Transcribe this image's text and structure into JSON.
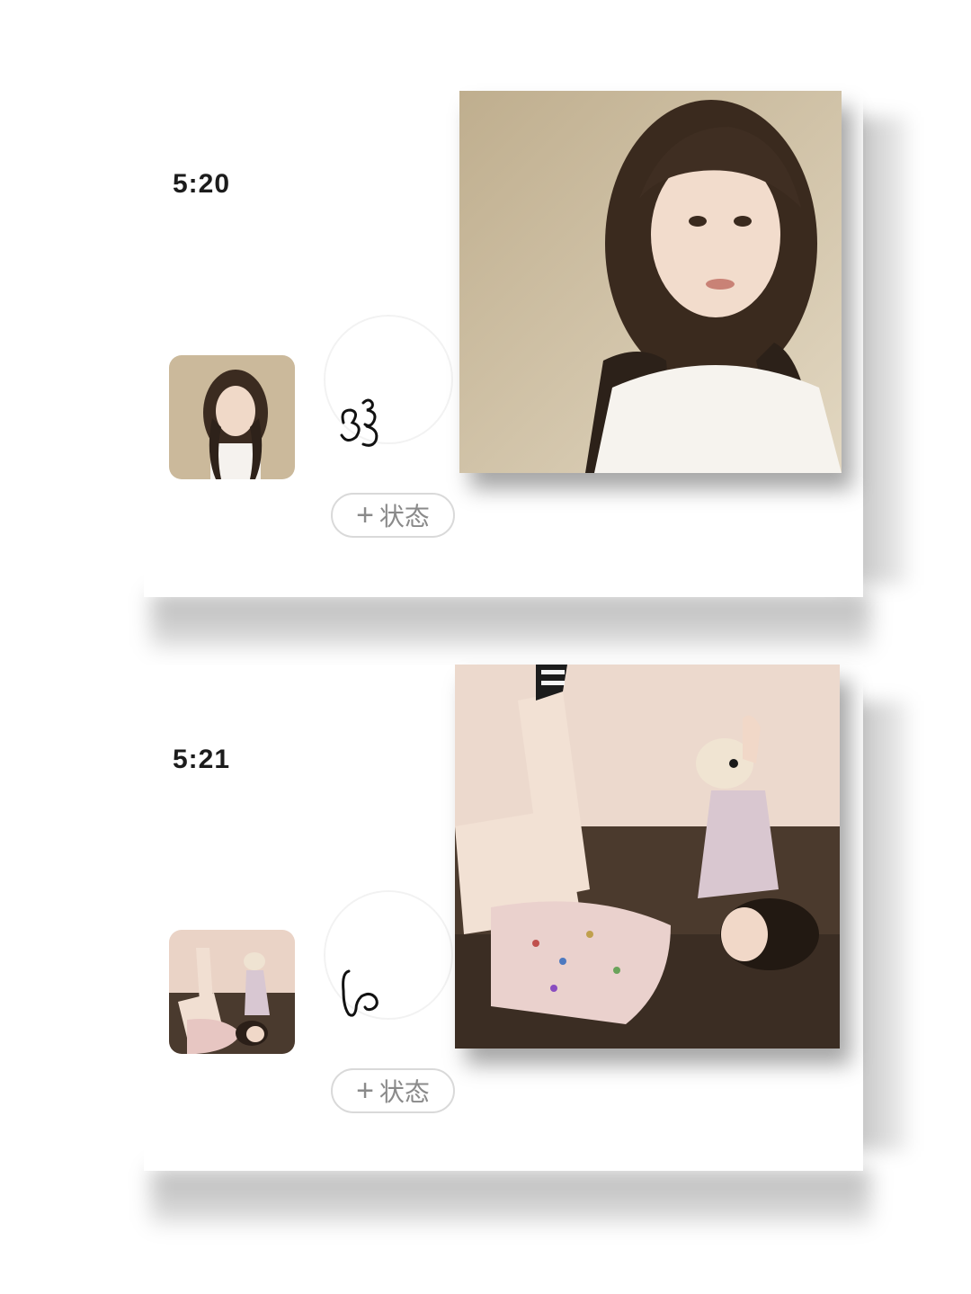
{
  "posts": [
    {
      "time": "5:20",
      "status_button": {
        "icon": "plus-icon",
        "label": "状态"
      },
      "doodle_icon": "scribble-3-icon",
      "photo_description": "girl-selfie",
      "colors": {
        "photo_bg": "#c9b89a",
        "photo_hair": "#3a2a1e",
        "photo_shirt": "#f4f0ea"
      }
    },
    {
      "time": "5:21",
      "status_button": {
        "icon": "plus-icon",
        "label": "状态"
      },
      "doodle_icon": "scribble-b-icon",
      "photo_description": "girl-on-sofa-with-dog",
      "colors": {
        "photo_bg": "#e9d2c6",
        "photo_sofa": "#4a3a2e",
        "photo_pants": "#f1dfd2"
      }
    }
  ]
}
